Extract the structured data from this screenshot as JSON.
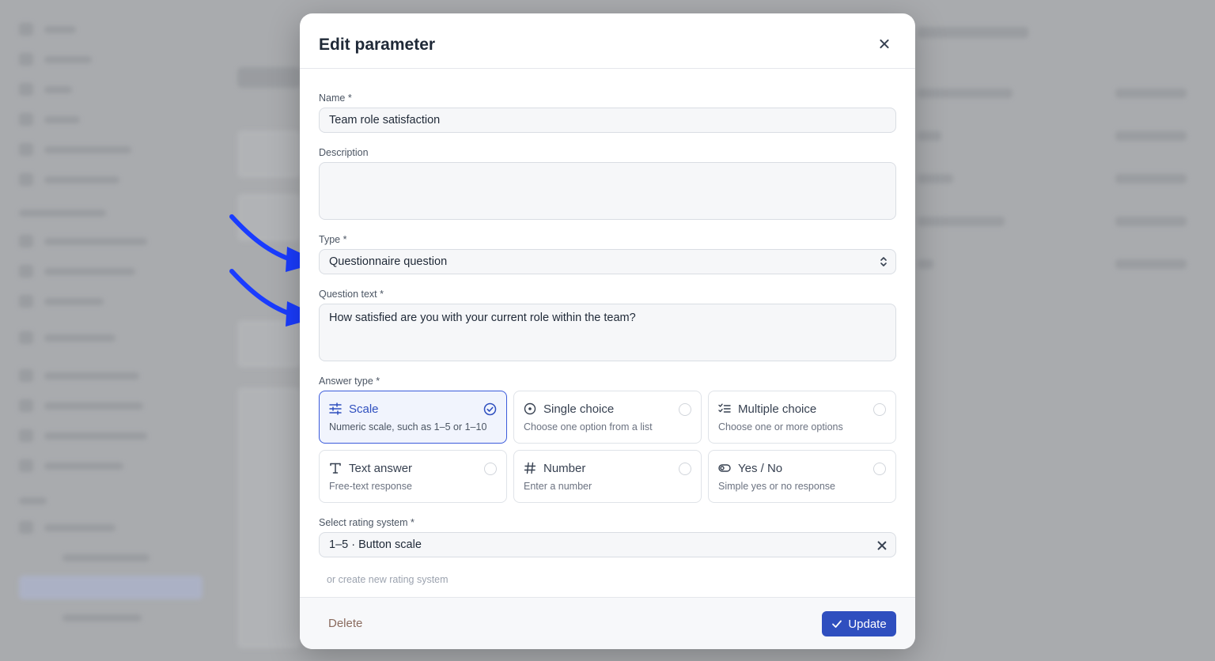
{
  "modal": {
    "title": "Edit parameter",
    "name": {
      "label": "Name *",
      "value": "Team role satisfaction"
    },
    "description": {
      "label": "Description",
      "value": ""
    },
    "type": {
      "label": "Type *",
      "value": "Questionnaire question"
    },
    "question_text": {
      "label": "Question text *",
      "value": "How satisfied are you with your current role within the team?"
    },
    "answer_type": {
      "label": "Answer type *",
      "selected": "Scale",
      "options": [
        {
          "title": "Scale",
          "desc": "Numeric scale, such as 1–5 or 1–10",
          "icon": "sliders-icon"
        },
        {
          "title": "Single choice",
          "desc": "Choose one option from a list",
          "icon": "radio-dot-icon"
        },
        {
          "title": "Multiple choice",
          "desc": "Choose one or more options",
          "icon": "checklist-icon"
        },
        {
          "title": "Text answer",
          "desc": "Free-text response",
          "icon": "text-t-icon"
        },
        {
          "title": "Number",
          "desc": "Enter a number",
          "icon": "hash-icon"
        },
        {
          "title": "Yes / No",
          "desc": "Simple yes or no response",
          "icon": "toggle-icon"
        }
      ]
    },
    "rating_system": {
      "label": "Select rating system *",
      "value": "1–5 · Button scale",
      "create_link": "or create new rating system"
    },
    "footer": {
      "delete_label": "Delete",
      "update_label": "Update"
    }
  },
  "colors": {
    "accent": "#2f4fbf",
    "arrow": "#1a3cff",
    "selected_border": "#3b5bdb"
  }
}
